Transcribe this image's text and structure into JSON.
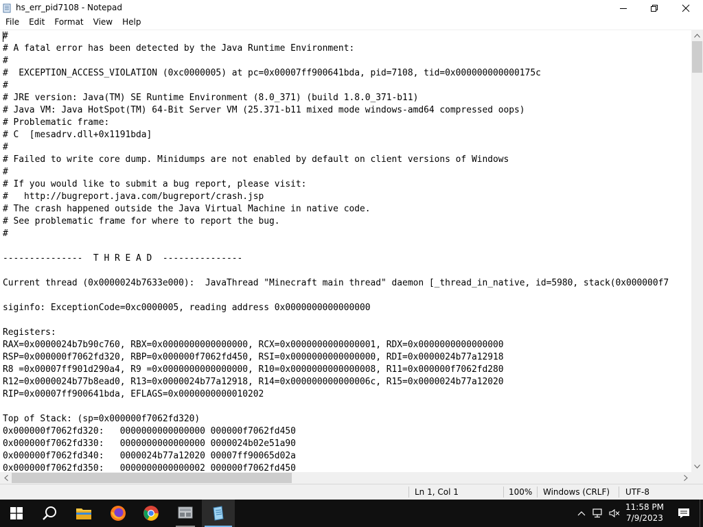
{
  "window": {
    "title": "hs_err_pid7108 - Notepad"
  },
  "menu": {
    "items": [
      "File",
      "Edit",
      "Format",
      "View",
      "Help"
    ]
  },
  "editor": {
    "lines": [
      "#",
      "# A fatal error has been detected by the Java Runtime Environment:",
      "#",
      "#  EXCEPTION_ACCESS_VIOLATION (0xc0000005) at pc=0x00007ff900641bda, pid=7108, tid=0x000000000000175c",
      "#",
      "# JRE version: Java(TM) SE Runtime Environment (8.0_371) (build 1.8.0_371-b11)",
      "# Java VM: Java HotSpot(TM) 64-Bit Server VM (25.371-b11 mixed mode windows-amd64 compressed oops)",
      "# Problematic frame:",
      "# C  [mesadrv.dll+0x1191bda]",
      "#",
      "# Failed to write core dump. Minidumps are not enabled by default on client versions of Windows",
      "#",
      "# If you would like to submit a bug report, please visit:",
      "#   http://bugreport.java.com/bugreport/crash.jsp",
      "# The crash happened outside the Java Virtual Machine in native code.",
      "# See problematic frame for where to report the bug.",
      "#",
      "",
      "---------------  T H R E A D  ---------------",
      "",
      "Current thread (0x0000024b7633e000):  JavaThread \"Minecraft main thread\" daemon [_thread_in_native, id=5980, stack(0x000000f7",
      "",
      "siginfo: ExceptionCode=0xc0000005, reading address 0x0000000000000000",
      "",
      "Registers:",
      "RAX=0x0000024b7b90c760, RBX=0x0000000000000000, RCX=0x0000000000000001, RDX=0x0000000000000000",
      "RSP=0x000000f7062fd320, RBP=0x000000f7062fd450, RSI=0x0000000000000000, RDI=0x0000024b77a12918",
      "R8 =0x00007ff901d290a4, R9 =0x0000000000000000, R10=0x0000000000000008, R11=0x000000f7062fd280",
      "R12=0x0000024b77b8ead0, R13=0x0000024b77a12918, R14=0x000000000000006c, R15=0x0000024b77a12020",
      "RIP=0x00007ff900641bda, EFLAGS=0x0000000000010202",
      "",
      "Top of Stack: (sp=0x000000f7062fd320)",
      "0x000000f7062fd320:   0000000000000000 000000f7062fd450",
      "0x000000f7062fd330:   0000000000000000 0000024b02e51a90",
      "0x000000f7062fd340:   0000024b77a12020 00007ff90065d02a",
      "0x000000f7062fd350:   0000000000000002 000000f7062fd450"
    ]
  },
  "status": {
    "position": "Ln 1, Col 1",
    "zoom": "100%",
    "line_ending": "Windows (CRLF)",
    "encoding": "UTF-8"
  },
  "taskbar": {
    "apps": [
      "start-icon",
      "search-icon",
      "file-explorer-icon",
      "firefox-icon",
      "chrome-icon",
      "minecraft-launcher-icon",
      "notepad-icon"
    ],
    "clock_time": "11:58 PM",
    "clock_date": "7/9/2023"
  },
  "colors": {
    "taskbar_bg": "#101010",
    "accent": "#76b9ed",
    "statusbar_bg": "#f0f0f0"
  }
}
